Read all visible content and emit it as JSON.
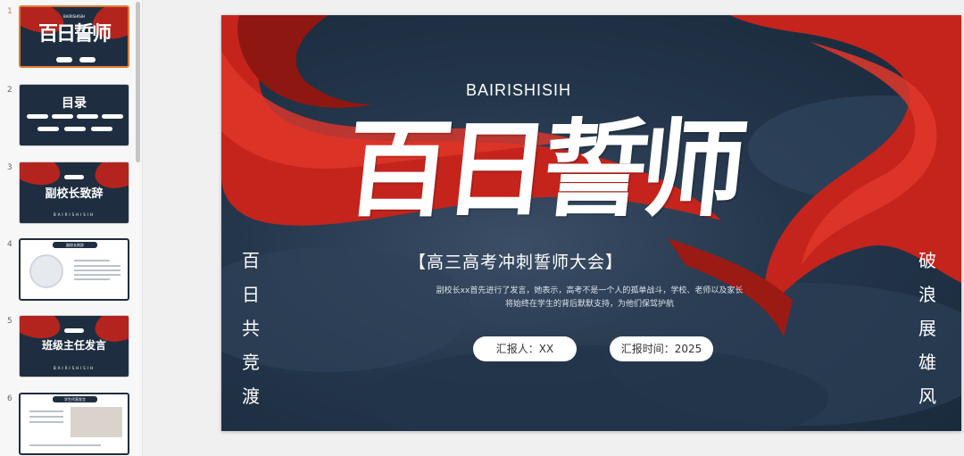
{
  "thumbnails": [
    {
      "num": "1",
      "title": "百日誓师",
      "caption": "BAIRISHISIH",
      "selected": true
    },
    {
      "num": "2",
      "title": "目录"
    },
    {
      "num": "3",
      "title": "副校长致辞",
      "caption": "BAIRISHISIH"
    },
    {
      "num": "4",
      "title": "副校长致辞"
    },
    {
      "num": "5",
      "title": "班级主任发言",
      "caption": "BAIRISHISIH"
    },
    {
      "num": "6",
      "title": "学生代表发言"
    }
  ],
  "slide": {
    "subtitle_en": "BAIRISHISIH",
    "title": "百日誓师",
    "conference": "【高三高考冲刺誓师大会】",
    "description_line1": "副校长xx首先进行了发言，她表示，高考不是一个人的孤单战斗，学校、老师以及家长",
    "description_line2": "将始终在学生的背后默默支持，为他们保驾护航",
    "reporter": "汇报人：XX",
    "report_time": "汇报时间：2025",
    "left_vertical": [
      "百",
      "日",
      "共",
      "竞",
      "渡"
    ],
    "right_vertical": [
      "破",
      "浪",
      "展",
      "雄",
      "风"
    ]
  },
  "colors": {
    "slide_bg": "#1e2e40",
    "ribbon_red": "#c4241c",
    "selected_border": "#e07a36"
  }
}
